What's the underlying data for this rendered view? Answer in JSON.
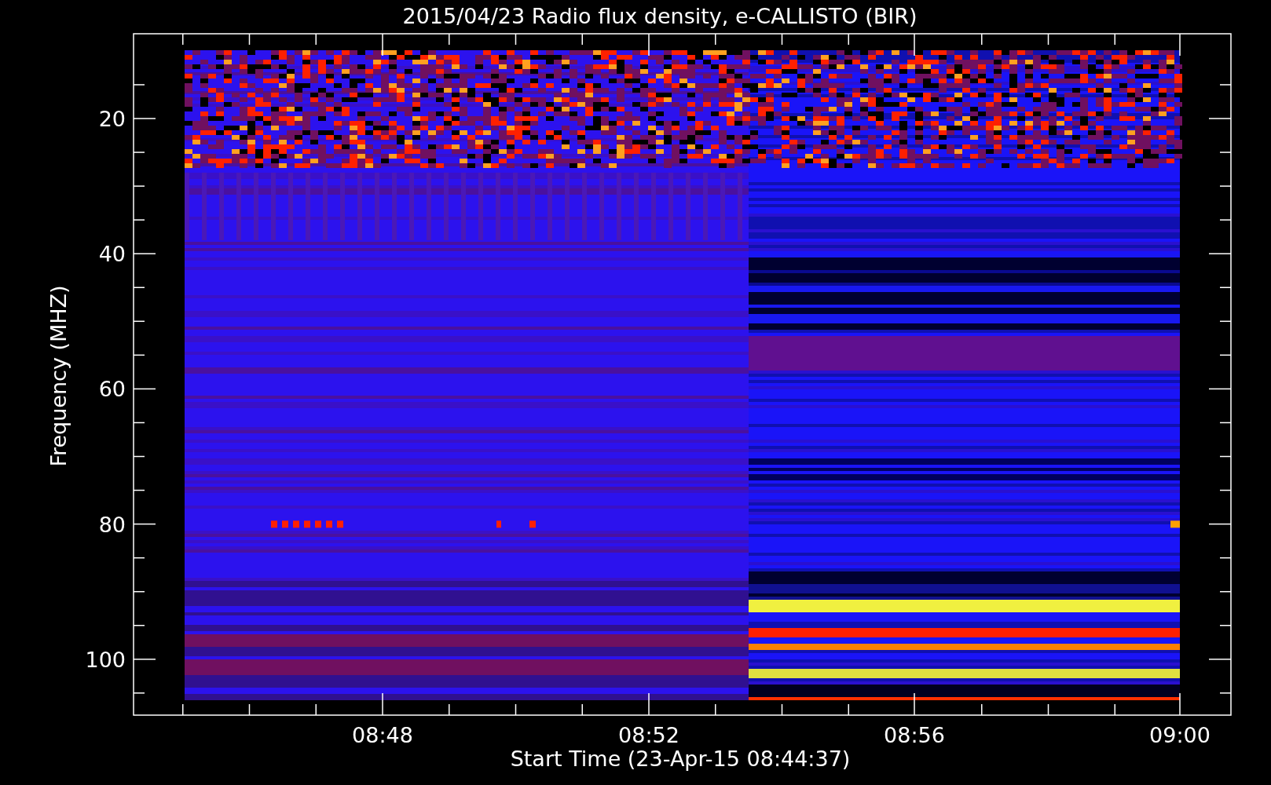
{
  "plot": {
    "title": "2015/04/23  Radio flux density, e-CALLISTO (BIR)",
    "ylabel": "Frequency (MHZ)",
    "xlabel": "Start Time (23-Apr-15 08:44:37)",
    "y_tick_labels": [
      "20",
      "40",
      "60",
      "80",
      "100"
    ],
    "x_tick_labels": [
      "08:48",
      "08:52",
      "08:56",
      "09:00"
    ]
  }
}
